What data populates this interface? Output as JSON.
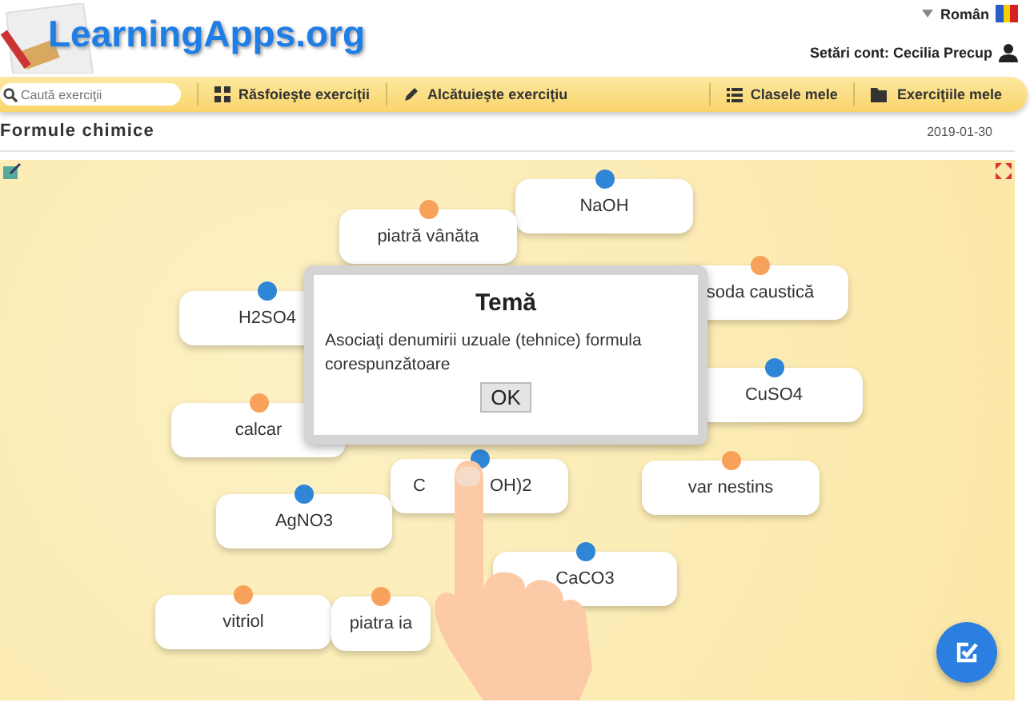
{
  "header": {
    "logo": "LearningApps.org",
    "language": "Român",
    "account": "Setări cont: Cecilia Precup"
  },
  "nav": {
    "search_placeholder": "Caută exerciţii",
    "items": [
      "Răsfoieşte exerciţii",
      "Alcătuieşte exerciţiu",
      "Clasele mele",
      "Exerciţiile mele"
    ]
  },
  "app": {
    "title": "Formule chimice",
    "date": "2019-01-30",
    "cards": [
      {
        "text": "NaOH",
        "color": "#2f86d6"
      },
      {
        "text": "piatră vânăta",
        "color": "#f7a15a"
      },
      {
        "text": "H2SO4",
        "color": "#2f86d6"
      },
      {
        "text": "soda caustică",
        "color": "#f7a15a"
      },
      {
        "text": "CuSO4",
        "color": "#2f86d6"
      },
      {
        "text": "calcar",
        "color": "#f7a15a"
      },
      {
        "text": "C",
        "text_after": "OH)2",
        "color": "#2f86d6"
      },
      {
        "text": "var nestins",
        "color": "#f7a15a"
      },
      {
        "text": "AgNO3",
        "color": "#2f86d6"
      },
      {
        "text": "CaCO3",
        "color": "#2f86d6"
      },
      {
        "text": "vitriol",
        "color": "#f7a15a"
      },
      {
        "text": "piatra ia",
        "color": "#f7a15a"
      }
    ],
    "dialog": {
      "title": "Temă",
      "message": "Asociaţi denumirii uzuale (tehnice) formula corespunzătoare",
      "button": "OK"
    }
  }
}
